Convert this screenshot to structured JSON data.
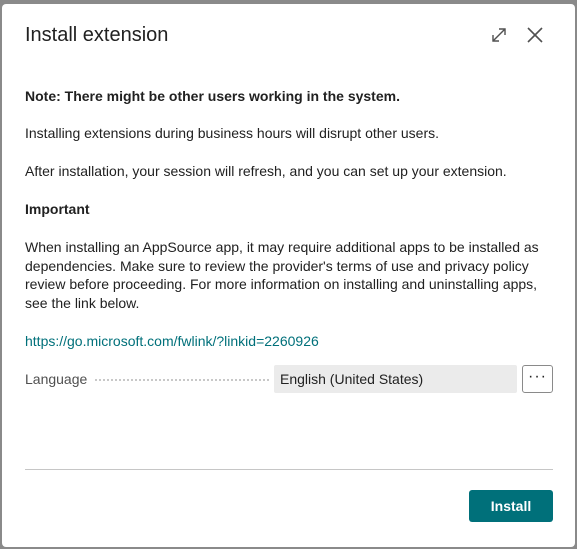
{
  "dialog": {
    "title": "Install extension",
    "expand_icon": "expand-icon",
    "close_icon": "close-icon",
    "note": "Note: There might be other users working in the system.",
    "paragraph1": "Installing extensions during business hours will disrupt other users.",
    "paragraph2": "After installation, your session will refresh, and you can set up your extension.",
    "important_heading": "Important",
    "important_text": "When installing an AppSource app, it may require additional apps to be installed as dependencies. Make sure to review the provider's terms of use and privacy policy review before proceeding. For more information on installing and uninstalling apps, see the link below.",
    "link": "https://go.microsoft.com/fwlink/?linkid=2260926",
    "language_label": "Language",
    "language_value": "English (United States)",
    "more_button_label": "···",
    "install_label": "Install"
  },
  "colors": {
    "accent": "#00707a",
    "text": "#212121",
    "field_bg": "#ebebeb"
  }
}
